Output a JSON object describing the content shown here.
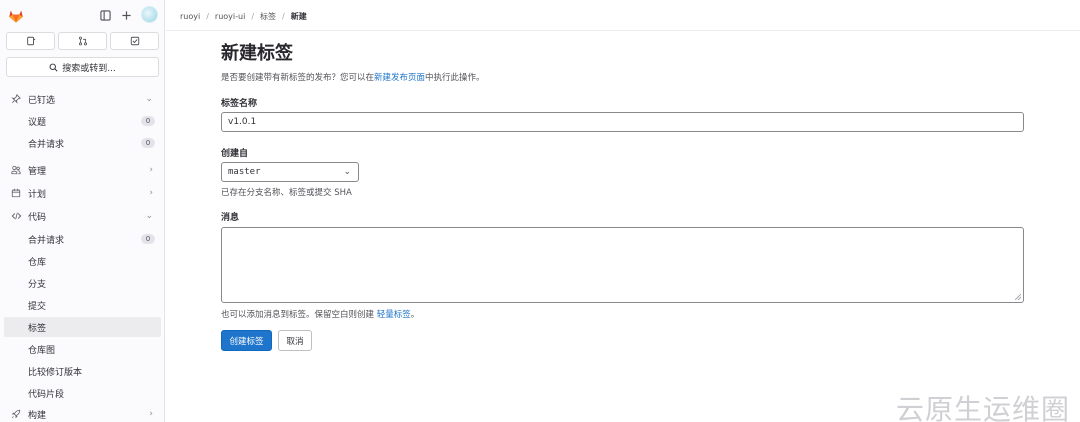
{
  "sidebar": {
    "search_label": "搜索或转到...",
    "items": [
      {
        "label": "已钉选"
      },
      {
        "label": "议题",
        "badge": "0"
      },
      {
        "label": "合并请求",
        "badge": "0"
      },
      {
        "label": "管理"
      },
      {
        "label": "计划"
      },
      {
        "label": "代码"
      },
      {
        "label": "合并请求",
        "badge": "0"
      },
      {
        "label": "仓库"
      },
      {
        "label": "分支"
      },
      {
        "label": "提交"
      },
      {
        "label": "标签"
      },
      {
        "label": "仓库图"
      },
      {
        "label": "比较修订版本"
      },
      {
        "label": "代码片段"
      },
      {
        "label": "构建"
      }
    ]
  },
  "breadcrumb": [
    "ruoyi",
    "ruoyi-ui",
    "标签",
    "新建"
  ],
  "page": {
    "title": "新建标签",
    "desc_prefix": "是否要创建带有新标签的发布？您可以在",
    "desc_link": "新建发布页面",
    "desc_suffix": "中执行此操作。",
    "tag_name_label": "标签名称",
    "tag_name_value": "v1.0.1",
    "create_from_label": "创建自",
    "create_from_value": "master",
    "create_from_help": "已存在分支名称、标签或提交 SHA",
    "message_label": "消息",
    "message_help_prefix": "也可以添加消息到标签。保留空白则创建 ",
    "message_help_link": "轻量标签",
    "message_help_suffix": "。",
    "submit_label": "创建标签",
    "cancel_label": "取消"
  },
  "watermark": "云原生运维圈",
  "colors": {
    "accent": "#1f75cb",
    "logo": "#e24329"
  }
}
